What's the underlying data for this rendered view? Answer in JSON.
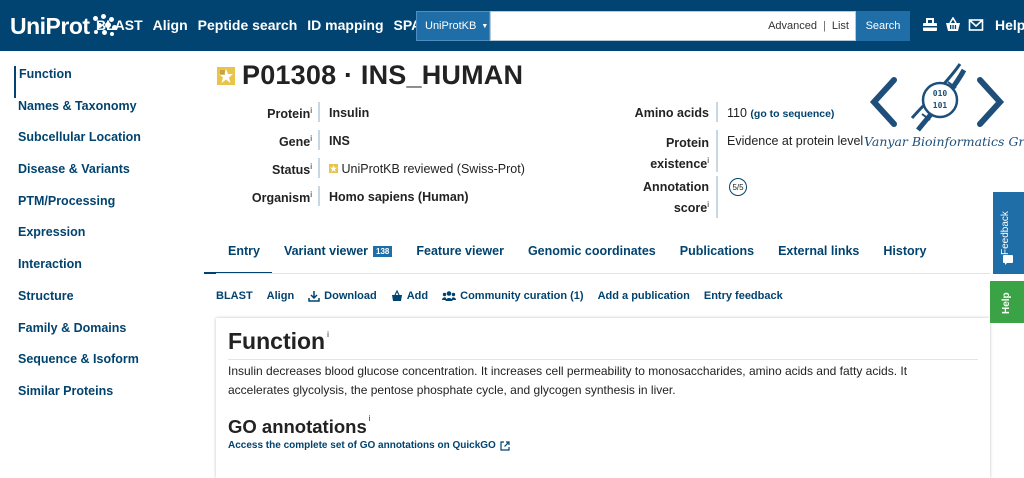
{
  "header": {
    "logo_text": "UniProt",
    "nav": [
      "BLAST",
      "Align",
      "Peptide search",
      "ID mapping",
      "SPARQL"
    ],
    "db_select": "UniProtKB",
    "search_placeholder": "",
    "advanced": "Advanced",
    "list": "List",
    "search_button": "Search",
    "help": "Help",
    "icons": [
      "basket-icon",
      "cart-icon",
      "mail-icon"
    ]
  },
  "sidebar": {
    "items": [
      {
        "label": "Function"
      },
      {
        "label": "Names & Taxonomy"
      },
      {
        "label": "Subcellular Location"
      },
      {
        "label": "Disease & Variants"
      },
      {
        "label": "PTM/Processing"
      },
      {
        "label": "Expression"
      },
      {
        "label": "Interaction"
      },
      {
        "label": "Structure"
      },
      {
        "label": "Family & Domains"
      },
      {
        "label": "Sequence & Isoform"
      },
      {
        "label": "Similar Proteins"
      }
    ]
  },
  "entry": {
    "title": "P01308 · INS_HUMAN",
    "protein_label": "Protein",
    "protein": "Insulin",
    "gene_label": "Gene",
    "gene": "INS",
    "status_label": "Status",
    "status": "UniProtKB reviewed (Swiss-Prot)",
    "organism_label": "Organism",
    "organism": "Homo sapiens (Human)",
    "amino_label": "Amino acids",
    "amino": "110",
    "amino_link": "(go to sequence)",
    "existence_label_1": "Protein",
    "existence_label_2": "existence",
    "existence": "Evidence at protein level",
    "annotation_label_1": "Annotation",
    "annotation_label_2": "score",
    "annotation_score": "5/5",
    "info_mark": "i"
  },
  "watermark": {
    "text": "Vanyar Bioinformatics Group",
    "dna_bits_1": "010",
    "dna_bits_2": "101",
    "color": "#1e4f7a"
  },
  "tabs": [
    {
      "label": "Entry"
    },
    {
      "label": "Variant viewer",
      "badge": "138"
    },
    {
      "label": "Feature viewer"
    },
    {
      "label": "Genomic coordinates"
    },
    {
      "label": "Publications"
    },
    {
      "label": "External links"
    },
    {
      "label": "History"
    }
  ],
  "toolbar": {
    "blast": "BLAST",
    "align": "Align",
    "download": "Download",
    "add": "Add",
    "community": "Community curation (1)",
    "add_publication": "Add a publication",
    "entry_feedback": "Entry feedback"
  },
  "function_card": {
    "title": "Function",
    "description": "Insulin decreases blood glucose concentration. It increases cell permeability to monosaccharides, amino acids and fatty acids. It accelerates glycolysis, the pentose phosphate cycle, and glycogen synthesis in liver.",
    "go_title": "GO annotations",
    "go_link": "Access the complete set of GO annotations on QuickGO"
  },
  "side": {
    "feedback": "Feedback",
    "help": "Help"
  },
  "colors": {
    "header_bg": "#014371",
    "link": "#01436f",
    "accent_blue": "#1f6ea8",
    "help_green": "#3aa346"
  }
}
